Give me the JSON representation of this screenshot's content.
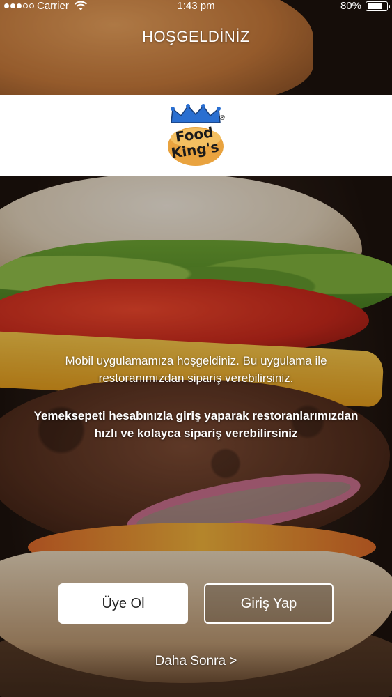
{
  "status_bar": {
    "carrier": "Carrier",
    "time": "1:43 pm",
    "battery": "80%",
    "battery_level": 0.8,
    "signal_bars_filled": 3,
    "signal_bars_total": 5
  },
  "header": {
    "title": "HOŞGELDİNİZ"
  },
  "logo": {
    "line1": "Food",
    "line2": "King's",
    "mark": "®"
  },
  "content": {
    "intro_line1": "Mobil uygulamamıza  hoşgeldiniz. Bu uygulama ile",
    "intro_line2": "restoranımızdan sipariş verebilirsiniz.",
    "bold_line1": "Yemeksepeti hesabınızla giriş yaparak restoranlarımızdan",
    "bold_line2": "hızlı ve kolayca sipariş verebilirsiniz"
  },
  "actions": {
    "register_label": "Üye Ol",
    "login_label": "Giriş Yap",
    "later_label": "Daha Sonra >"
  },
  "colors": {
    "logo_crown": "#2a6fd1",
    "logo_text": "#1b1b1b",
    "logo_bun": "#e9a33f"
  }
}
